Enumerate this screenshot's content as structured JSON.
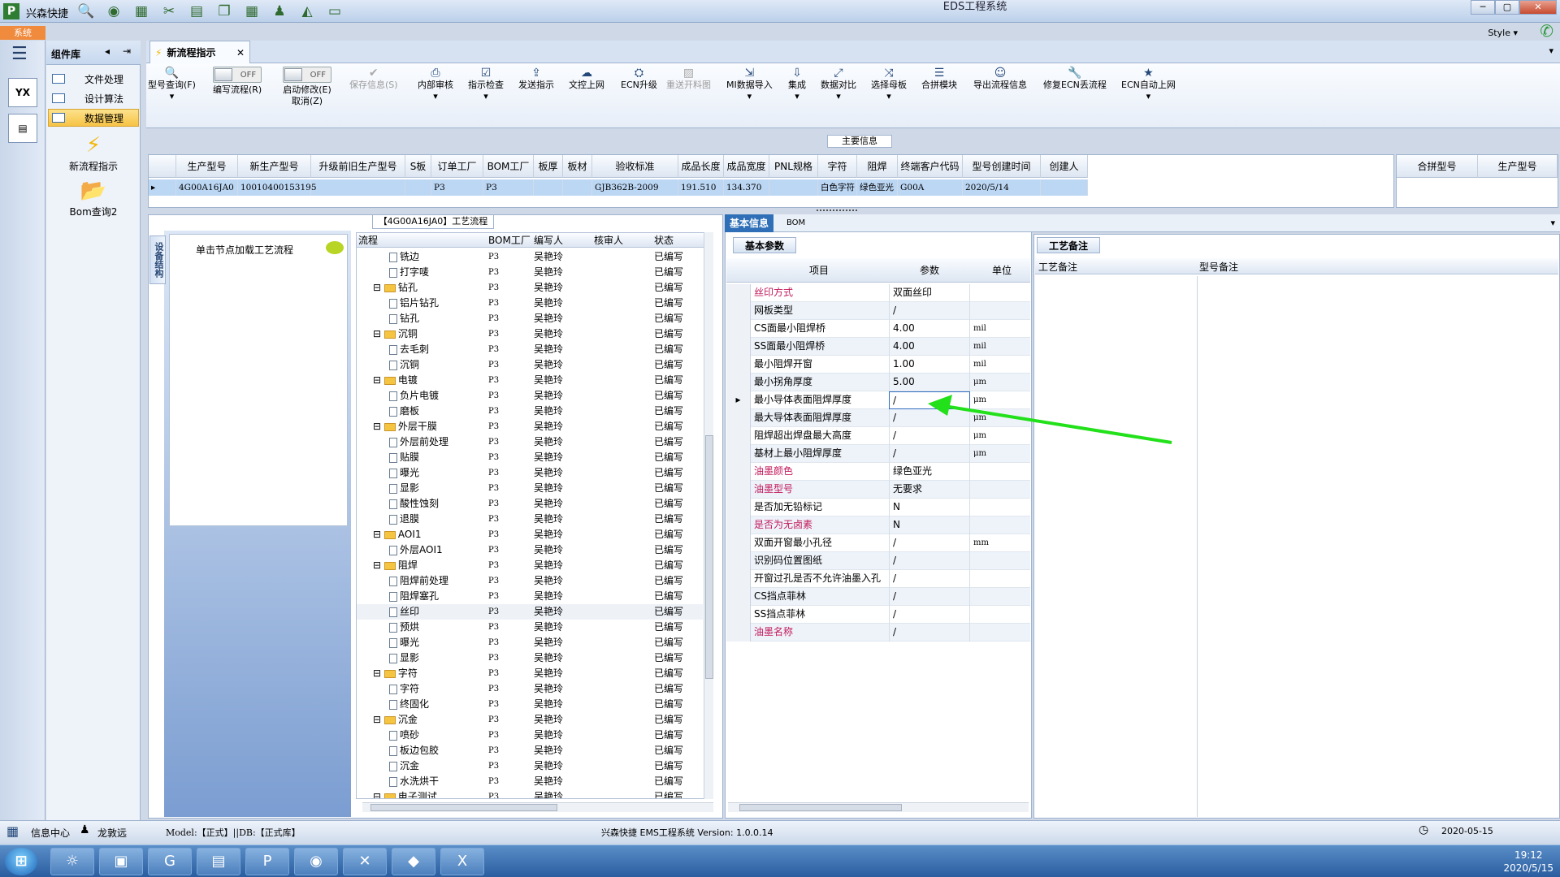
{
  "app": {
    "name": "兴森快捷",
    "window_title": "EDS工程系统",
    "system_tab": "系统",
    "style_label": "Style"
  },
  "components": {
    "title": "组件库",
    "items": [
      {
        "label": "文件处理"
      },
      {
        "label": "设计算法"
      },
      {
        "label": "数据管理",
        "selected": true
      }
    ],
    "tools": [
      {
        "label": "新流程指示",
        "icon": "lightning-icon"
      },
      {
        "label": "Bom查询2",
        "icon": "folder-open-icon"
      }
    ]
  },
  "doc_tab": {
    "label": "新流程指示"
  },
  "ribbon": {
    "items": [
      {
        "label": "型号查询(F)",
        "icon": "magnifier-icon"
      },
      {
        "label": "编写流程(R)",
        "toggle": "OFF"
      },
      {
        "label": "启动修改(E)",
        "sub": "取消(Z)",
        "toggle": "OFF"
      },
      {
        "label": "保存信息(S)",
        "icon": "check-icon",
        "disabled": true
      },
      {
        "label": "内部审核",
        "icon": "printer-icon"
      },
      {
        "label": "指示检查",
        "icon": "check-box-icon"
      },
      {
        "label": "发送指示",
        "icon": "upload-icon"
      },
      {
        "label": "文控上网",
        "icon": "cloud-icon"
      },
      {
        "label": "ECN升级",
        "icon": "ecn-icon"
      },
      {
        "label": "重送开料图",
        "icon": "image-icon",
        "disabled": true
      },
      {
        "label": "MI数据导入",
        "icon": "import-icon"
      },
      {
        "label": "集成",
        "icon": "download-icon"
      },
      {
        "label": "数据对比",
        "icon": "compare-icon"
      },
      {
        "label": "选择母板",
        "icon": "shuffle-icon"
      },
      {
        "label": "合拼模块",
        "icon": "list-icon"
      },
      {
        "label": "导出流程信息",
        "icon": "export-icon"
      },
      {
        "label": "修复ECN丢流程",
        "icon": "wrench-icon"
      },
      {
        "label": "ECN自动上网",
        "icon": "star-icon"
      }
    ]
  },
  "main_info": {
    "label": "主要信息",
    "columns": [
      "生产型号",
      "新生产型号",
      "升级前旧生产型号",
      "S板",
      "订单工厂",
      "BOM工厂",
      "板厚",
      "板材",
      "验收标准",
      "成品长度",
      "成品宽度",
      "PNL规格",
      "字符",
      "阻焊",
      "终端客户代码",
      "型号创建时间",
      "创建人"
    ],
    "row": [
      "4G00A16JA0",
      "10010400153195",
      "",
      "",
      "P3",
      "P3",
      "",
      "",
      "GJB362B-2009",
      "191.510",
      "134.370",
      "",
      "白色字符",
      "绿色亚光",
      "G00A",
      "2020/5/14",
      ""
    ],
    "side_columns": [
      "合拼型号",
      "生产型号"
    ]
  },
  "process": {
    "title": "【4G00A16JA0】工艺流程",
    "side_tab": "设备结构",
    "node_hint": "单击节点加载工艺流程",
    "columns": [
      "流程",
      "BOM工厂",
      "编写人",
      "核审人",
      "状态"
    ],
    "rows": [
      {
        "name": "铣边",
        "level": 2,
        "factory": "P3",
        "writer": "吴艳玲",
        "status": "已编写"
      },
      {
        "name": "打字唛",
        "level": 2,
        "factory": "P3",
        "writer": "吴艳玲",
        "status": "已编写"
      },
      {
        "name": "钻孔",
        "level": 1,
        "factory": "P3",
        "writer": "吴艳玲",
        "status": "已编写"
      },
      {
        "name": "铝片钻孔",
        "level": 2,
        "factory": "P3",
        "writer": "吴艳玲",
        "status": "已编写"
      },
      {
        "name": "钻孔",
        "level": 2,
        "factory": "P3",
        "writer": "吴艳玲",
        "status": "已编写"
      },
      {
        "name": "沉铜",
        "level": 1,
        "factory": "P3",
        "writer": "吴艳玲",
        "status": "已编写"
      },
      {
        "name": "去毛刺",
        "level": 2,
        "factory": "P3",
        "writer": "吴艳玲",
        "status": "已编写"
      },
      {
        "name": "沉铜",
        "level": 2,
        "factory": "P3",
        "writer": "吴艳玲",
        "status": "已编写"
      },
      {
        "name": "电镀",
        "level": 1,
        "factory": "P3",
        "writer": "吴艳玲",
        "status": "已编写"
      },
      {
        "name": "负片电镀",
        "level": 2,
        "factory": "P3",
        "writer": "吴艳玲",
        "status": "已编写"
      },
      {
        "name": "磨板",
        "level": 2,
        "factory": "P3",
        "writer": "吴艳玲",
        "status": "已编写"
      },
      {
        "name": "外层干膜",
        "level": 1,
        "factory": "P3",
        "writer": "吴艳玲",
        "status": "已编写"
      },
      {
        "name": "外层前处理",
        "level": 2,
        "factory": "P3",
        "writer": "吴艳玲",
        "status": "已编写"
      },
      {
        "name": "贴膜",
        "level": 2,
        "factory": "P3",
        "writer": "吴艳玲",
        "status": "已编写"
      },
      {
        "name": "曝光",
        "level": 2,
        "factory": "P3",
        "writer": "吴艳玲",
        "status": "已编写"
      },
      {
        "name": "显影",
        "level": 2,
        "factory": "P3",
        "writer": "吴艳玲",
        "status": "已编写"
      },
      {
        "name": "酸性蚀刻",
        "level": 2,
        "factory": "P3",
        "writer": "吴艳玲",
        "status": "已编写"
      },
      {
        "name": "退膜",
        "level": 2,
        "factory": "P3",
        "writer": "吴艳玲",
        "status": "已编写"
      },
      {
        "name": "AOI1",
        "level": 1,
        "factory": "P3",
        "writer": "吴艳玲",
        "status": "已编写"
      },
      {
        "name": "外层AOI1",
        "level": 2,
        "factory": "P3",
        "writer": "吴艳玲",
        "status": "已编写"
      },
      {
        "name": "阻焊",
        "level": 1,
        "factory": "P3",
        "writer": "吴艳玲",
        "status": "已编写"
      },
      {
        "name": "阻焊前处理",
        "level": 2,
        "factory": "P3",
        "writer": "吴艳玲",
        "status": "已编写"
      },
      {
        "name": "阻焊塞孔",
        "level": 2,
        "factory": "P3",
        "writer": "吴艳玲",
        "status": "已编写"
      },
      {
        "name": "丝印",
        "level": 2,
        "factory": "P3",
        "writer": "吴艳玲",
        "status": "已编写",
        "selected": true
      },
      {
        "name": "预烘",
        "level": 2,
        "factory": "P3",
        "writer": "吴艳玲",
        "status": "已编写"
      },
      {
        "name": "曝光",
        "level": 2,
        "factory": "P3",
        "writer": "吴艳玲",
        "status": "已编写"
      },
      {
        "name": "显影",
        "level": 2,
        "factory": "P3",
        "writer": "吴艳玲",
        "status": "已编写"
      },
      {
        "name": "字符",
        "level": 1,
        "factory": "P3",
        "writer": "吴艳玲",
        "status": "已编写"
      },
      {
        "name": "字符",
        "level": 2,
        "factory": "P3",
        "writer": "吴艳玲",
        "status": "已编写"
      },
      {
        "name": "终固化",
        "level": 2,
        "factory": "P3",
        "writer": "吴艳玲",
        "status": "已编写"
      },
      {
        "name": "沉金",
        "level": 1,
        "factory": "P3",
        "writer": "吴艳玲",
        "status": "已编写"
      },
      {
        "name": "喷砂",
        "level": 2,
        "factory": "P3",
        "writer": "吴艳玲",
        "status": "已编写"
      },
      {
        "name": "板边包胶",
        "level": 2,
        "factory": "P3",
        "writer": "吴艳玲",
        "status": "已编写"
      },
      {
        "name": "沉金",
        "level": 2,
        "factory": "P3",
        "writer": "吴艳玲",
        "status": "已编写"
      },
      {
        "name": "水洗烘干",
        "level": 2,
        "factory": "P3",
        "writer": "吴艳玲",
        "status": "已编写"
      },
      {
        "name": "电子测试",
        "level": 1,
        "factory": "P3",
        "writer": "吴艳玲",
        "status": "已编写"
      }
    ]
  },
  "basic": {
    "tabs": [
      "基本信息",
      "BOM"
    ],
    "subtab": "基本参数",
    "columns": [
      "项目",
      "参数",
      "单位"
    ],
    "rows": [
      {
        "item": "丝印方式",
        "value": "双面丝印",
        "unit": "",
        "pink": true
      },
      {
        "item": "网板类型",
        "value": "/",
        "unit": ""
      },
      {
        "item": "CS面最小阻焊桥",
        "value": "4.00",
        "unit": "mil"
      },
      {
        "item": "SS面最小阻焊桥",
        "value": "4.00",
        "unit": "mil"
      },
      {
        "item": "最小阻焊开窗",
        "value": "1.00",
        "unit": "mil"
      },
      {
        "item": "最小拐角厚度",
        "value": "5.00",
        "unit": "μm"
      },
      {
        "item": "最小导体表面阻焊厚度",
        "value": "/",
        "unit": "μm",
        "selected": true
      },
      {
        "item": "最大导体表面阻焊厚度",
        "value": "/",
        "unit": "μm"
      },
      {
        "item": "阻焊超出焊盘最大高度",
        "value": "/",
        "unit": "μm"
      },
      {
        "item": "基材上最小阻焊厚度",
        "value": "/",
        "unit": "μm"
      },
      {
        "item": "油墨颜色",
        "value": "绿色亚光",
        "unit": "",
        "pink": true
      },
      {
        "item": "油墨型号",
        "value": "无要求",
        "unit": "",
        "pink": true
      },
      {
        "item": "是否加无铅标记",
        "value": "N",
        "unit": ""
      },
      {
        "item": "是否为无卤素",
        "value": "N",
        "unit": "",
        "pink": true
      },
      {
        "item": "双面开窗最小孔径",
        "value": "/",
        "unit": "mm"
      },
      {
        "item": "识别码位置图纸",
        "value": "/",
        "unit": ""
      },
      {
        "item": "开窗过孔是否不允许油墨入孔",
        "value": "/",
        "unit": ""
      },
      {
        "item": "CS挡点菲林",
        "value": "/",
        "unit": ""
      },
      {
        "item": "SS挡点菲林",
        "value": "/",
        "unit": ""
      },
      {
        "item": "油墨名称",
        "value": "/",
        "unit": "",
        "pink": true
      }
    ]
  },
  "remarks": {
    "tab": "工艺备注",
    "col1": "工艺备注",
    "col2": "型号备注"
  },
  "status_bar": {
    "info": "信息中心",
    "user": "龙敦远",
    "model": "Model:【正式】||DB:【正式库】",
    "app_version": "兴森快捷  EMS工程系统  Version: 1.0.0.14",
    "date": "2020-05-15"
  },
  "taskbar": {
    "time": "19:12",
    "date": "2020/5/15"
  },
  "colors": {
    "accent": "#2f6fb7",
    "arrow": "#22e01a",
    "pink": "#c2185b",
    "selection": "#bcd7f4"
  }
}
